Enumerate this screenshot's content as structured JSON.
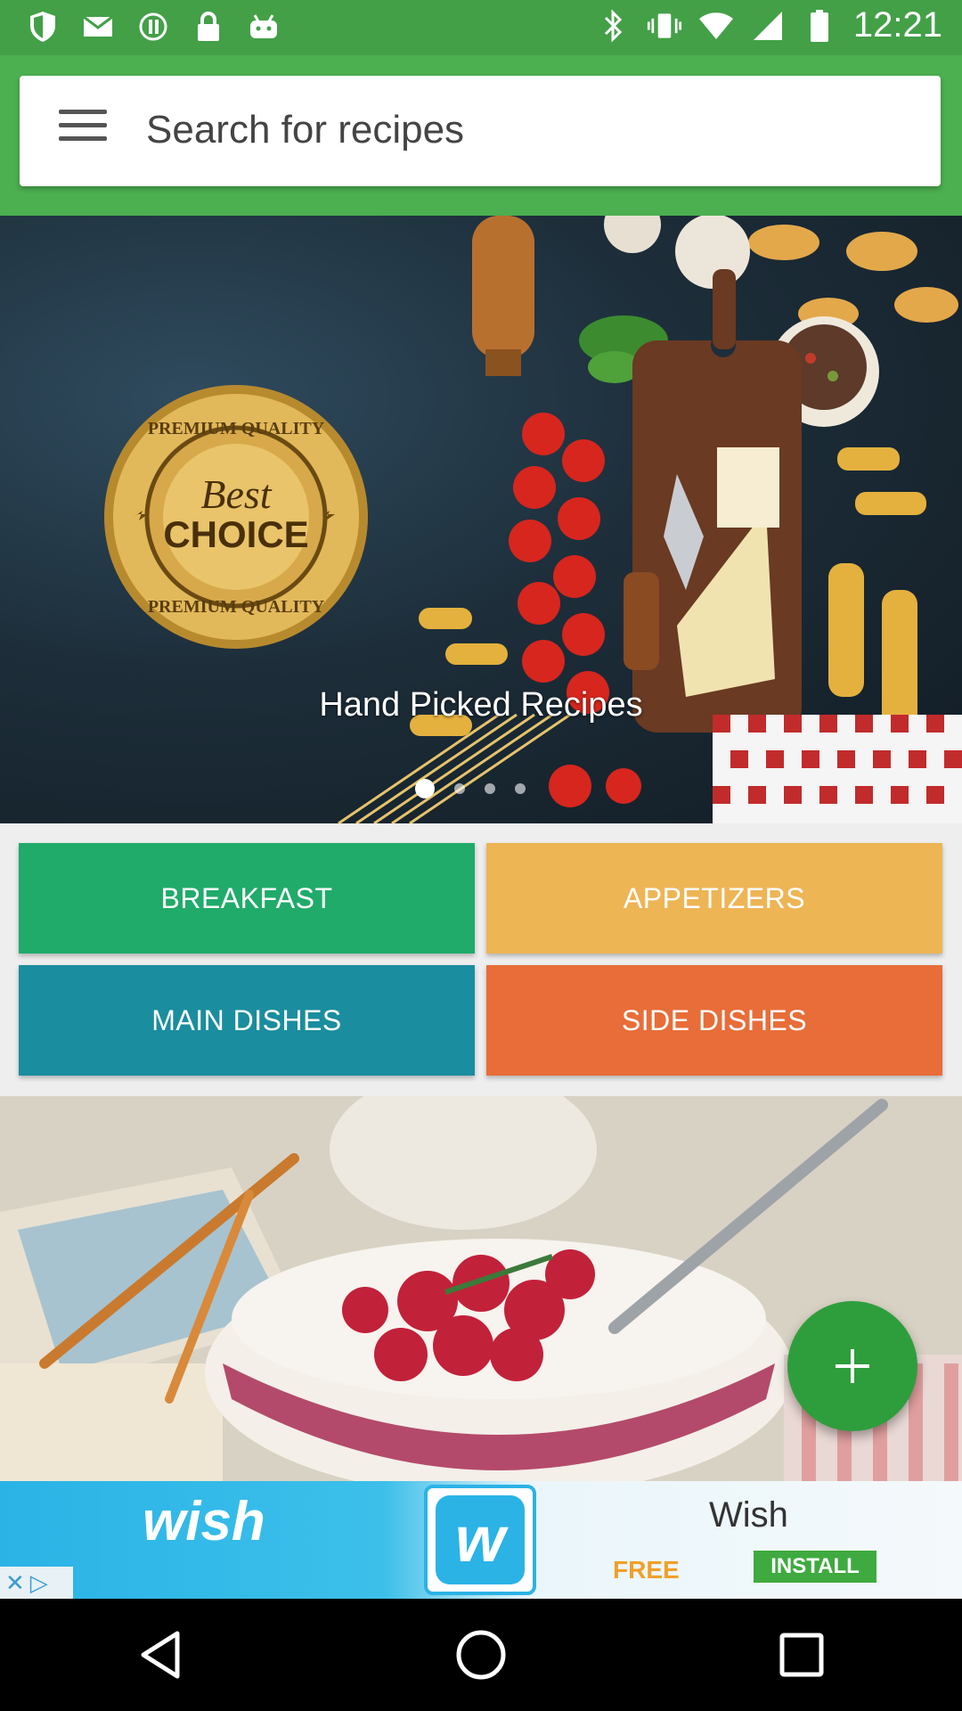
{
  "status_bar": {
    "time": "12:21",
    "left_icons": [
      "shield-icon",
      "mail-icon",
      "info-icon",
      "lock-icon",
      "android-icon"
    ],
    "right_icons": [
      "bluetooth-icon",
      "vibrate-icon",
      "wifi-icon",
      "signal-icon",
      "battery-icon"
    ]
  },
  "search": {
    "placeholder": "Search for recipes"
  },
  "hero": {
    "caption": "Hand Picked Recipes",
    "badge_text": [
      "PREMIUM QUALITY",
      "Best",
      "CHOICE",
      "PREMIUM QUALITY"
    ],
    "active_slide": 1,
    "slide_count": 4
  },
  "categories": [
    {
      "label": "BREAKFAST",
      "color": "#20ab6a"
    },
    {
      "label": "APPETIZERS",
      "color": "#eeb555"
    },
    {
      "label": "MAIN DISHES",
      "color": "#1a8d9e"
    },
    {
      "label": "SIDE DISHES",
      "color": "#e86d38"
    }
  ],
  "ad": {
    "brand": "wish",
    "logo_letter": "w",
    "title": "Wish",
    "free_label": "FREE",
    "install_label": "INSTALL"
  },
  "colors": {
    "status_bar": "#43a047",
    "header": "#4caf50",
    "fab": "#2e9e3c"
  }
}
